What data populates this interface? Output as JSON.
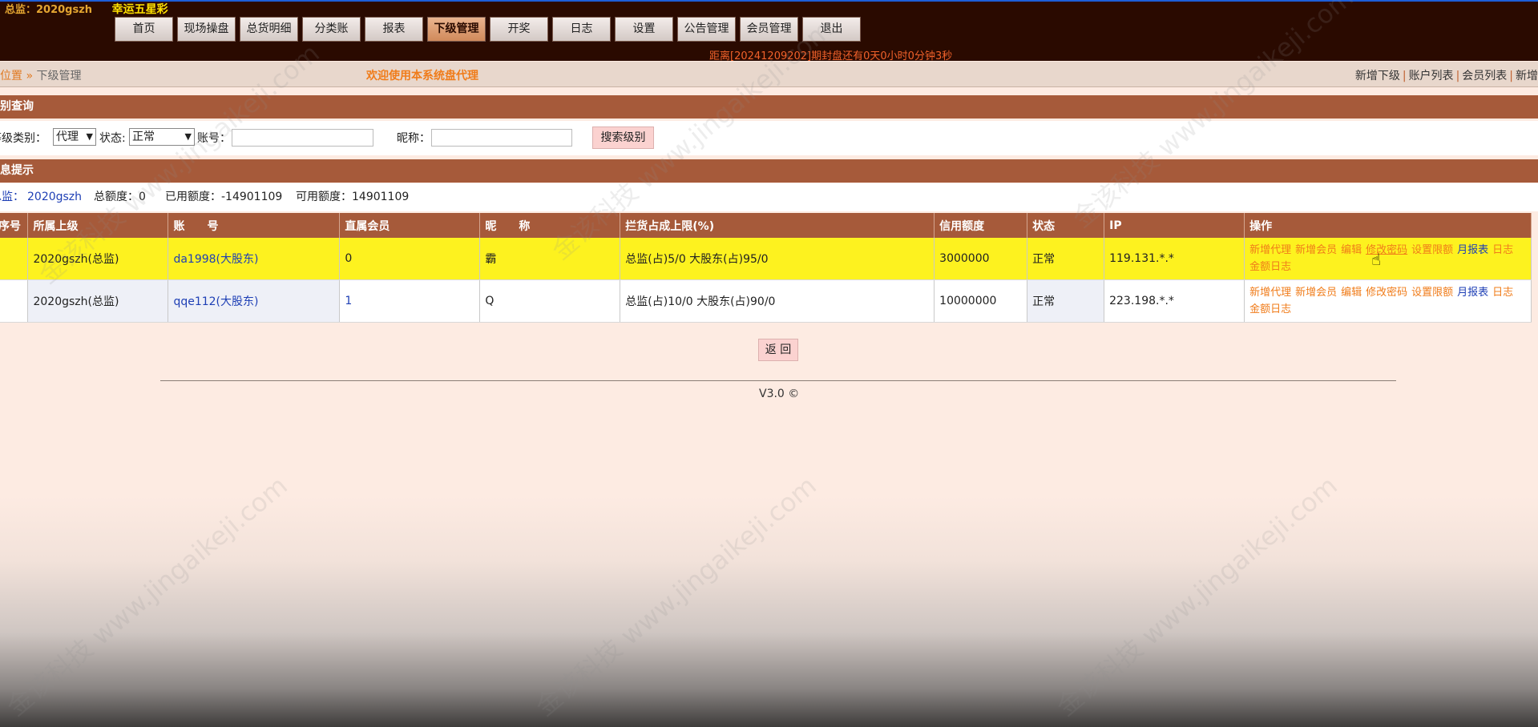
{
  "header": {
    "account_label": "总监：2020gszh",
    "game_name": "幸运五星彩",
    "nav": [
      "首页",
      "现场操盘",
      "总货明细",
      "分类账",
      "报表",
      "下级管理",
      "开奖",
      "日志",
      "设置",
      "公告管理",
      "会员管理",
      "退出"
    ],
    "active_nav": "下级管理",
    "countdown": "距离[20241209202]期封盘还有0天0小时0分钟3秒"
  },
  "breadcrumb": {
    "location": "位置",
    "separator": "»",
    "current": "下级管理"
  },
  "welcome": "欢迎使用本系统盘代理",
  "right_links": [
    "新增下级",
    "账户列表",
    "会员列表",
    "新增"
  ],
  "query": {
    "title": "级别查询",
    "level_label": "等级类别：",
    "level_value": "代理",
    "status_label": "状态:",
    "status_value": "正常",
    "account_label": "账号：",
    "account_value": "",
    "nickname_label": "昵称：",
    "nickname_value": "",
    "search_button": "搜索级别"
  },
  "info": {
    "title": "信息提示",
    "owner_label": "总监：",
    "owner_value": "2020gszh",
    "total_credit": "总额度：0",
    "used_credit": "已用额度：-14901109",
    "available_credit": "可用额度：14901109"
  },
  "table": {
    "headers": [
      "序号",
      "所属上级",
      "账　　号",
      "直属会员",
      "昵　　称",
      "拦货占成上限(%)",
      "信用额度",
      "状态",
      "IP",
      "操作"
    ],
    "rows": [
      {
        "index": "",
        "parent": "2020gszh(总监)",
        "account": "da1998(大股东)",
        "members": "0",
        "nickname": "霸",
        "limit": "总监(占)5/0 大股东(占)95/0",
        "credit": "3000000",
        "status": "正常",
        "ip": "119.131.*.*"
      },
      {
        "index": "",
        "parent": "2020gszh(总监)",
        "account": "qqe112(大股东)",
        "members": "1",
        "nickname": "Q",
        "limit": "总监(占)10/0 大股东(占)90/0",
        "credit": "10000000",
        "status": "正常",
        "ip": "223.198.*.*"
      }
    ],
    "ops": [
      "新增代理",
      "新增会员",
      "编辑",
      "修改密码",
      "设置限额",
      "月报表",
      "日志",
      "金额日志"
    ]
  },
  "back_button": "返 回",
  "version": "V3.0 ©",
  "watermark": "金该科技 www.jingaikeji.com",
  "colors": {
    "header_bg": "#2a0a00",
    "section_bg": "#a65a3a",
    "highlight_row": "#fdf21f",
    "link_orange": "#f07c1a",
    "link_blue": "#1e3fb5"
  }
}
